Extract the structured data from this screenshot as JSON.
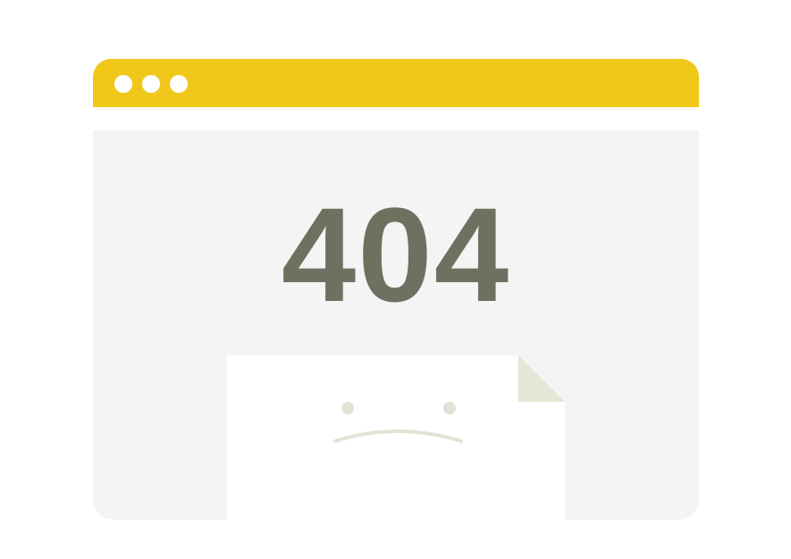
{
  "window": {
    "titlebar_color": "#f0c81a",
    "content_color": "#f4f4f4",
    "dots": [
      "window-dot",
      "window-dot",
      "window-dot"
    ]
  },
  "error": {
    "code": "404",
    "color": "#6f705f"
  },
  "illustration": {
    "icon": "sad-document-icon",
    "page_color": "#ffffff",
    "fold_color": "#e6e6d6",
    "face_color": "#e2e3d4"
  }
}
